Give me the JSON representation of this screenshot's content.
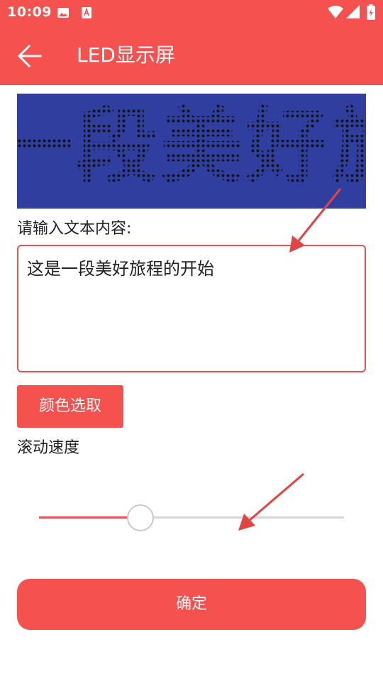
{
  "status_bar": {
    "time": "10:09",
    "icons": [
      "gallery-icon",
      "a-icon",
      "wifi-icon",
      "signal-icon",
      "battery-icon"
    ]
  },
  "app_bar": {
    "title": "LED显示屏",
    "back_icon": "arrow-left-icon"
  },
  "led_display": {
    "visible_text": "一段美好旅",
    "background_color": "#303f9f",
    "dot_color": "#111111"
  },
  "input": {
    "label": "请输入文本内容:",
    "value": "这是一段美好旅程的开始",
    "border_color": "#e05555"
  },
  "color_button": {
    "label": "颜色选取"
  },
  "speed": {
    "label": "滚动速度",
    "value_percent": 33
  },
  "confirm_button": {
    "label": "确定"
  },
  "colors": {
    "accent": "#f5524f",
    "annotation_arrow": "#e04545"
  }
}
